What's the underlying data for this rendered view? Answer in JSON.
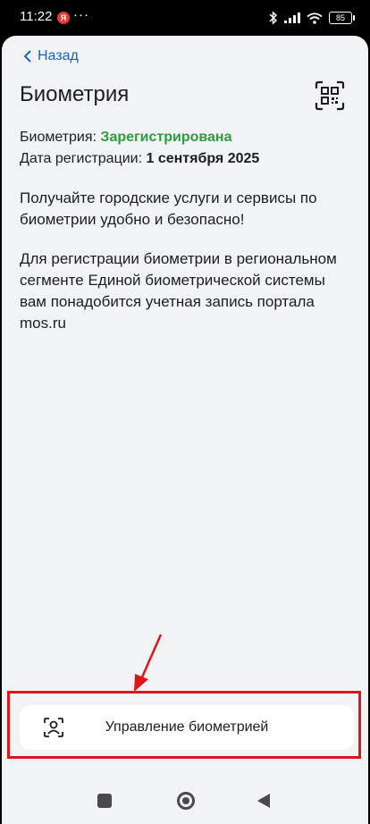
{
  "statusbar": {
    "time": "11:22",
    "ya_badge": "Я",
    "dots": "···",
    "battery": "85"
  },
  "nav": {
    "back_label": "Назад"
  },
  "page": {
    "title": "Биометрия"
  },
  "status": {
    "label": "Биометрия: ",
    "value": "Зарегистрирована",
    "value_color": "#2e9b3f",
    "date_label": "Дата регистрации: ",
    "date_value": "1 сентября 2025"
  },
  "content": {
    "paragraph1": "Получайте городские услуги и сервисы по биометрии удобно и безопасно!",
    "paragraph2": "Для регистрации биометрии в региональном сегменте Единой биометрической системы вам понадобится учетная запись портала mos.ru"
  },
  "actions": {
    "manage_label": "Управление биометрией"
  },
  "colors": {
    "accent": "#1565c0",
    "highlight": "#e0151c"
  }
}
